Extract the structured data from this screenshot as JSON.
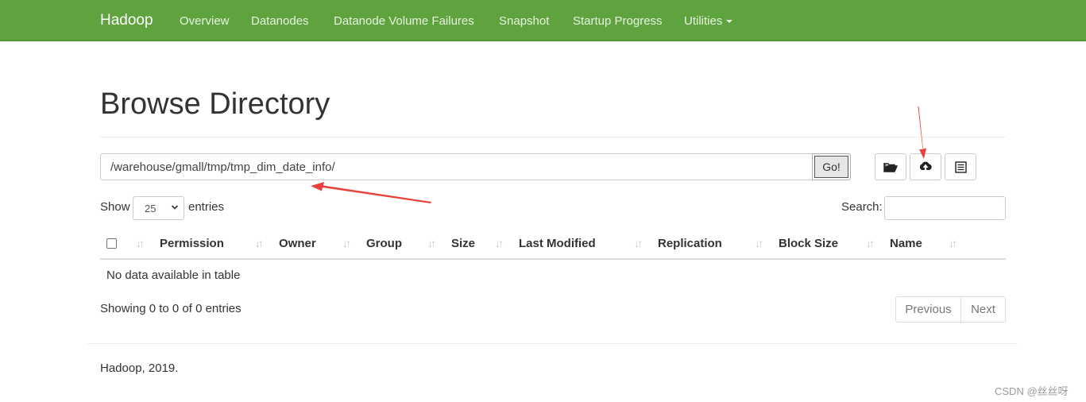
{
  "navbar": {
    "brand": "Hadoop",
    "items": [
      "Overview",
      "Datanodes",
      "Datanode Volume Failures",
      "Snapshot",
      "Startup Progress",
      "Utilities"
    ],
    "color": "#5fa33e"
  },
  "page": {
    "title": "Browse Directory"
  },
  "path_bar": {
    "value": "/warehouse/gmall/tmp/tmp_dim_date_info/",
    "go_label": "Go!"
  },
  "toolbar": {
    "icons": [
      "folder-open-icon",
      "upload-icon",
      "list-icon"
    ]
  },
  "table_controls": {
    "show_label": "Show",
    "page_length": "25",
    "entries_label": "entries",
    "search_label": "Search:"
  },
  "table": {
    "columns": [
      "Permission",
      "Owner",
      "Group",
      "Size",
      "Last Modified",
      "Replication",
      "Block Size",
      "Name"
    ],
    "empty_message": "No data available in table"
  },
  "pagination": {
    "info": "Showing 0 to 0 of 0 entries",
    "previous_label": "Previous",
    "next_label": "Next"
  },
  "footer": {
    "text": "Hadoop, 2019."
  },
  "watermark": {
    "text": "CSDN @丝丝呀"
  },
  "annotation_color": "#e8413c"
}
